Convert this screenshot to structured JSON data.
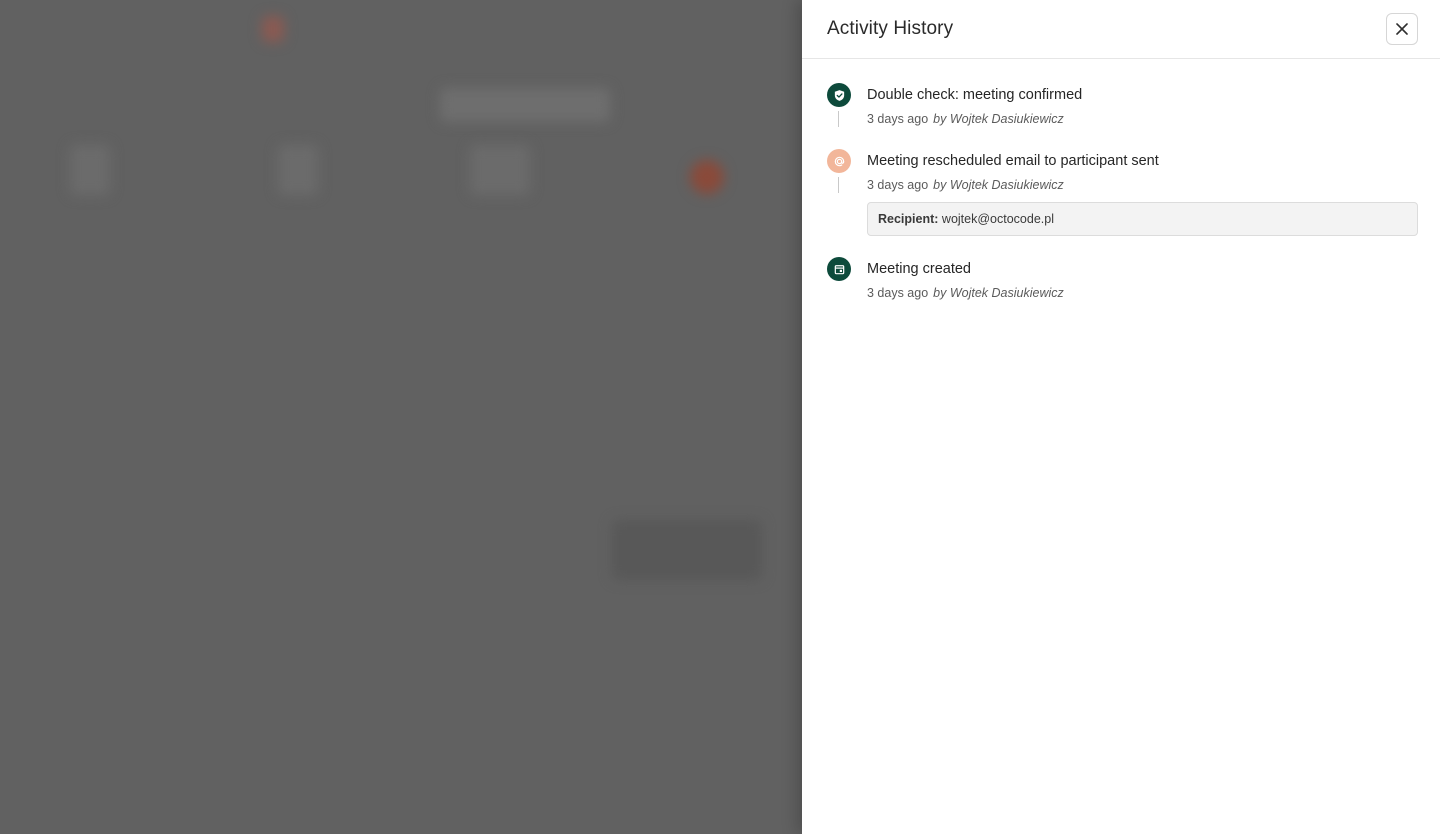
{
  "drawer": {
    "title": "Activity History",
    "close_icon": "close-icon"
  },
  "events": [
    {
      "title": "Double check: meeting confirmed",
      "time": "3 days ago",
      "by": "by Wojtek Dasiukiewicz",
      "icon": "shield-check-icon",
      "icon_color": "#0d4a3b"
    },
    {
      "title": "Meeting rescheduled email to participant sent",
      "time": "3 days ago",
      "by": "by Wojtek Dasiukiewicz",
      "icon": "at-sign-icon",
      "icon_color": "#f2b69a",
      "detail_label": "Recipient:",
      "detail_value": "wojtek@octocode.pl"
    },
    {
      "title": "Meeting created",
      "time": "3 days ago",
      "by": "by Wojtek Dasiukiewicz",
      "icon": "calendar-icon",
      "icon_color": "#0d4a3b"
    }
  ]
}
